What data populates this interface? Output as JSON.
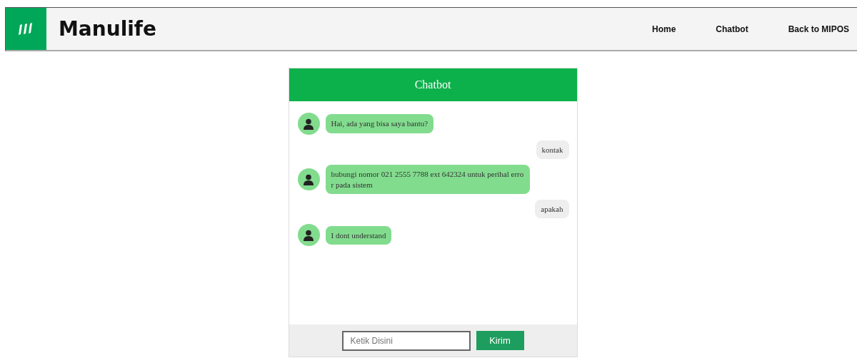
{
  "brand": "Manulife",
  "nav": [
    {
      "label": "Home"
    },
    {
      "label": "Chatbot"
    },
    {
      "label": "Back to MIPOS"
    }
  ],
  "chat": {
    "title": "Chatbot",
    "messages": [
      {
        "kind": "bot",
        "text": "Hai, ada yang bisa saya bantu?"
      },
      {
        "kind": "user",
        "text": "kontak"
      },
      {
        "kind": "bot",
        "text": "hubungi nomor 021 2555 7788 ext 642324 untuk perihal error pada sistem"
      },
      {
        "kind": "user",
        "text": "apakah"
      },
      {
        "kind": "bot",
        "text": "I dont understand"
      }
    ],
    "input": {
      "placeholder": "Ketik Disini"
    },
    "send": "Kirim"
  }
}
